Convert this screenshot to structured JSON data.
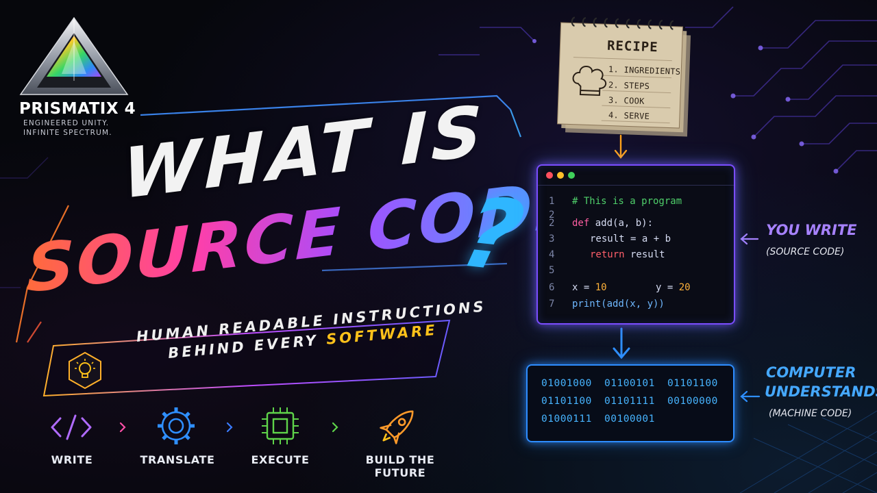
{
  "brand": {
    "name": "PRISMATIX 4",
    "tagline_line1": "ENGINEERED UNITY.",
    "tagline_line2": "INFINITE SPECTRUM."
  },
  "headline": {
    "line1": "WHAT IS",
    "line2": "SOURCE CODE",
    "question_mark": "?"
  },
  "subtitle": {
    "line1": "HUMAN READABLE INSTRUCTIONS",
    "line2_prefix": "BEHIND EVERY ",
    "line2_accent": "SOFTWARE"
  },
  "steps": [
    {
      "label": "WRITE",
      "icon": "code-brackets-icon",
      "color": "#b06bff"
    },
    {
      "label": "TRANSLATE",
      "icon": "gear-icon",
      "color": "#2f8fff"
    },
    {
      "label": "EXECUTE",
      "icon": "cpu-chip-icon",
      "color": "#5fd44a"
    },
    {
      "label": "BUILD THE FUTURE",
      "icon": "rocket-icon",
      "color": "#ff9a2a"
    }
  ],
  "recipe": {
    "title": "RECIPE",
    "items": [
      "1. INGREDIENTS",
      "2. STEPS",
      "3. COOK",
      "4. SERVE"
    ]
  },
  "editor": {
    "line_numbers": [
      "1",
      "2",
      "2",
      "3",
      "4",
      "5",
      "6",
      "7"
    ],
    "lines": {
      "comment": "# This is a program",
      "def_kw": "def",
      "def_rest": " add(a, b):",
      "result_line": "result = a + b",
      "return_kw": "return",
      "return_rest": " result",
      "x_part": "x = ",
      "x_val": "10",
      "y_part": "y = ",
      "y_val": "20",
      "print_line": "print(add(x, y))"
    }
  },
  "machine_code": {
    "bytes": [
      "01001000",
      "01100101",
      "01101100",
      "01101100",
      "01101111",
      "00100000",
      "01000111",
      "00100001"
    ]
  },
  "annotations": {
    "you_write": "YOU WRITE",
    "you_write_sub": "(SOURCE CODE)",
    "computer_line1": "COMPUTER",
    "computer_line2": "UNDERSTANDS",
    "computer_sub": "(MACHINE CODE)"
  },
  "colors": {
    "editor_border": "#7b4dff",
    "machine_border": "#2e8dff",
    "accent_yellow": "#ffc21a",
    "arrow_orange": "#ffa21a",
    "arrow_blue": "#2f8fff",
    "arrow_purple": "#a782ff"
  }
}
